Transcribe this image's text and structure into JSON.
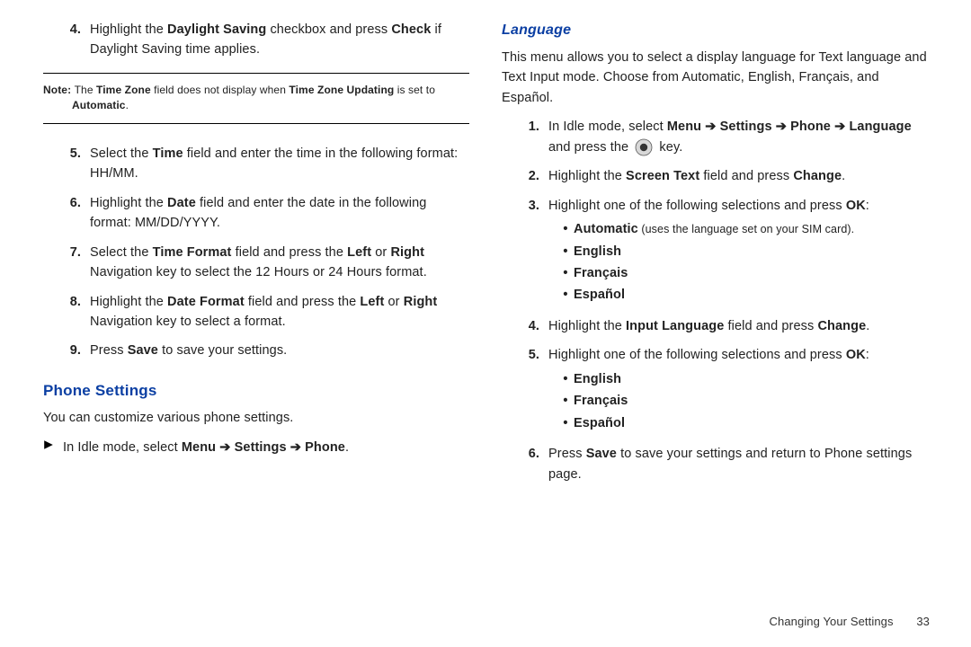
{
  "left": {
    "item4_pre": "Highlight the ",
    "item4_b1": "Daylight Saving",
    "item4_mid": " checkbox and press ",
    "item4_b2": "Check",
    "item4_post": " if Daylight Saving time applies.",
    "note_lead": "Note: ",
    "note_a": "The ",
    "note_b1": "Time Zone",
    "note_b": " field does not display when ",
    "note_b2": "Time Zone Updating",
    "note_c": " is set to ",
    "note_b3": "Automatic",
    "note_d": ".",
    "item5_pre": "Select the ",
    "item5_b1": "Time",
    "item5_post": " field and enter the time in the following format: HH/MM.",
    "item6_pre": "Highlight the ",
    "item6_b1": "Date",
    "item6_post": " field and enter the date in the following format: MM/DD/YYYY.",
    "item7_pre": "Select the ",
    "item7_b1": "Time Format",
    "item7_mid": " field and press the ",
    "item7_b2": "Left",
    "item7_or": " or ",
    "item7_b3": "Right",
    "item7_post": " Navigation key to select the 12 Hours or 24 Hours format.",
    "item8_pre": "Highlight the ",
    "item8_b1": "Date Format",
    "item8_mid": " field and press the ",
    "item8_b2": "Left",
    "item8_or": " or ",
    "item8_b3": "Right",
    "item8_post": " Navigation key to select a format.",
    "item9_pre": "Press ",
    "item9_b1": "Save",
    "item9_post": " to save your settings.",
    "phone_h": "Phone Settings",
    "phone_intro": "You can customize various phone settings.",
    "phone_nav_pre": "In Idle mode, select ",
    "phone_nav_b": "Menu ➔ Settings ➔ Phone",
    "phone_nav_post": "."
  },
  "right": {
    "lang_h": "Language",
    "lang_intro": "This menu allows you to select a display language for Text language and Text Input mode. Choose from Automatic, English, Français, and Español.",
    "r1_pre": "In Idle mode, select ",
    "r1_b1": "Menu ➔ Settings ➔ Phone ➔ Language",
    "r1_mid": " and press the ",
    "r1_post": " key.",
    "r2_pre": "Highlight the ",
    "r2_b1": "Screen Text",
    "r2_mid": " field and press ",
    "r2_b2": "Change",
    "r2_post": ".",
    "r3_pre": "Highlight one of the following selections and press ",
    "r3_b1": "OK",
    "r3_post": ":",
    "r3_opt1_b": "Automatic",
    "r3_opt1_note": " (uses the language set on your SIM card).",
    "r3_opt2": "English",
    "r3_opt3": "Français",
    "r3_opt4": "Español",
    "r4_pre": "Highlight the ",
    "r4_b1": "Input Language",
    "r4_mid": " field and press ",
    "r4_b2": "Change",
    "r4_post": ".",
    "r5_pre": "Highlight one of the following selections and press ",
    "r5_b1": "OK",
    "r5_post": ":",
    "r5_opt1": "English",
    "r5_opt2": "Français",
    "r5_opt3": "Español",
    "r6_pre": "Press ",
    "r6_b1": "Save",
    "r6_post": " to save your settings and return to Phone settings page."
  },
  "num": {
    "n4": "4.",
    "n5": "5.",
    "n6": "6.",
    "n7": "7.",
    "n8": "8.",
    "n9": "9.",
    "r1": "1.",
    "r2": "2.",
    "r3": "3.",
    "r4": "4.",
    "r5": "5.",
    "r6": "6."
  },
  "footer": {
    "section": "Changing Your Settings",
    "page": "33"
  }
}
